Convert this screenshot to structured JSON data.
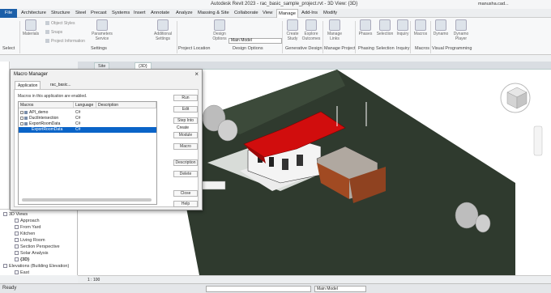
{
  "app": {
    "title": "Autodesk Revit 2023 - rac_basic_sample_project.rvt - 3D View: {3D}",
    "user": "manusha.cad...",
    "status": "Ready",
    "model_selector": "Main Model"
  },
  "menu": [
    "File",
    "Architecture",
    "Structure",
    "Steel",
    "Precast",
    "Systems",
    "Insert",
    "Annotate",
    "Analyze",
    "Massing & Site",
    "Collaborate",
    "View",
    "Manage",
    "Add-Ins",
    "Modify"
  ],
  "ribbon": {
    "buttons": [
      "Materials",
      "Parameters Service",
      "Additional Settings",
      "Design Options",
      "Create Study",
      "Explore Outcomes",
      "Manage Links",
      "Phases",
      "Selection",
      "Inquiry",
      "Macros",
      "Dynamo",
      "Dynamo Player"
    ],
    "small_items": [
      "Object Styles",
      "Snaps",
      "Project Information"
    ],
    "panels": [
      "Settings",
      "Project Location",
      "Design Options",
      "Generative Design",
      "Manage Project",
      "Phasing",
      "Selection",
      "Inquiry",
      "Macros",
      "Visual Programming"
    ],
    "main_model": "Main Model",
    "select_label": "Select"
  },
  "view_tabs": [
    "Site",
    "{3D}"
  ],
  "project_browser": {
    "items": [
      {
        "label": "3D Views",
        "level": 0
      },
      {
        "label": "Approach",
        "level": 1
      },
      {
        "label": "From Yard",
        "level": 1
      },
      {
        "label": "Kitchen",
        "level": 1
      },
      {
        "label": "Living Room",
        "level": 1
      },
      {
        "label": "Section Perspective",
        "level": 1
      },
      {
        "label": "Solar Analysis",
        "level": 1
      },
      {
        "label": "{3D}",
        "level": 1
      },
      {
        "label": "Elevations (Building Elevation)",
        "level": 0
      },
      {
        "label": "East",
        "level": 1
      }
    ]
  },
  "view_control": {
    "scale": "1 : 100"
  },
  "dialog": {
    "title": "Macro Manager",
    "tabs": [
      "Application",
      "rac_basic..."
    ],
    "message": "Macros in this application are enabled.",
    "columns": [
      "Macros",
      "Language",
      "Description"
    ],
    "rows": [
      {
        "name": "API_demo",
        "language": "C#",
        "indent": 0,
        "expander": "+"
      },
      {
        "name": "DuctIntersection",
        "language": "C#",
        "indent": 0,
        "expander": "+"
      },
      {
        "name": "ExportRoomData",
        "language": "C#",
        "indent": 0,
        "expander": "-"
      },
      {
        "name": "ExportRoomData",
        "language": "C#",
        "indent": 1,
        "selected": true
      }
    ],
    "buttons": [
      "Run",
      "Edit",
      "Step Into",
      "Create",
      "Module",
      "Macro",
      "Description",
      "Delete",
      "Close",
      "Help"
    ]
  },
  "colors": {
    "accent": "#1c5fa8",
    "selection": "#0a64c8",
    "roof": "#d10d0d",
    "terrain": "#2f3a2e"
  }
}
